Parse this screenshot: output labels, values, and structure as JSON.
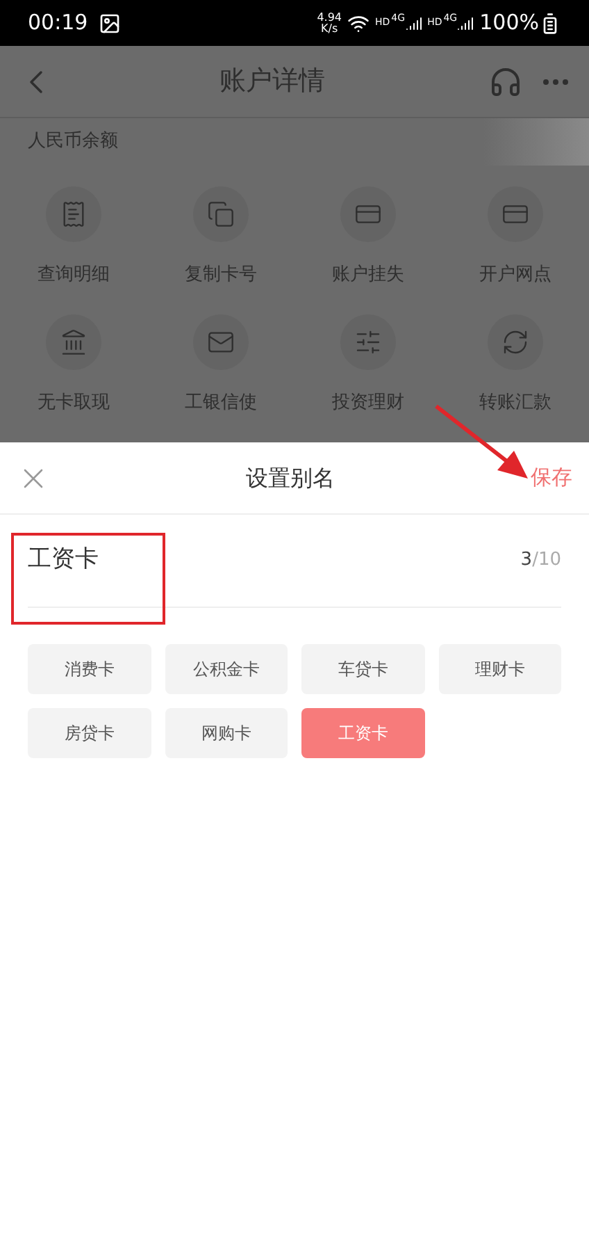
{
  "status_bar": {
    "time": "00:19",
    "speed": "4.94",
    "speed_unit": "K/s",
    "hd_1": "HD",
    "net_1": "4G",
    "hd_2": "HD",
    "net_2": "4G",
    "battery": "100%"
  },
  "header": {
    "title": "账户详情"
  },
  "balance": {
    "label": "人民币余额"
  },
  "actions": [
    {
      "label": "查询明细",
      "kind": "statement"
    },
    {
      "label": "复制卡号",
      "kind": "copy"
    },
    {
      "label": "账户挂失",
      "kind": "card-alert"
    },
    {
      "label": "开户网点",
      "kind": "card-pin"
    },
    {
      "label": "无卡取现",
      "kind": "atm"
    },
    {
      "label": "工银信使",
      "kind": "mail"
    },
    {
      "label": "投资理财",
      "kind": "invest"
    },
    {
      "label": "转账汇款",
      "kind": "exchange"
    }
  ],
  "sheet": {
    "title": "设置别名",
    "save": "保存",
    "value": "工资卡",
    "count": "3",
    "max": "/10"
  },
  "chips": [
    {
      "label": "消费卡",
      "selected": false
    },
    {
      "label": "公积金卡",
      "selected": false
    },
    {
      "label": "车贷卡",
      "selected": false
    },
    {
      "label": "理财卡",
      "selected": false
    },
    {
      "label": "房贷卡",
      "selected": false
    },
    {
      "label": "网购卡",
      "selected": false
    },
    {
      "label": "工资卡",
      "selected": true
    }
  ]
}
